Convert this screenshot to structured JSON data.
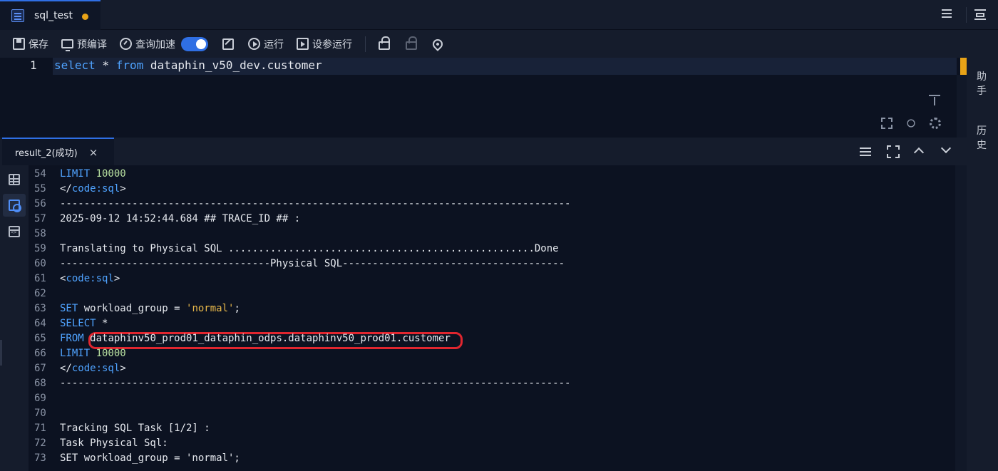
{
  "tab": {
    "title": "sql_test",
    "unsaved_color": "#e8a317"
  },
  "toolbar": {
    "save": "保存",
    "precompile": "预编译",
    "query_accel": "查询加速",
    "query_accel_on": true,
    "run": "运行",
    "run_with_params": "设参运行"
  },
  "editor": {
    "line_number": "1",
    "code_kw1": "select",
    "code_star": " * ",
    "code_kw2": "from",
    "code_rest": " dataphin_v50_dev.customer"
  },
  "side_panel": {
    "assistant": "助手",
    "history": "历史"
  },
  "result": {
    "tab_label": "result_2(成功)",
    "close": "×"
  },
  "log": [
    {
      "n": "54",
      "parts": [
        {
          "t": "LIMIT ",
          "c": "kw"
        },
        {
          "t": "10000",
          "c": "num"
        }
      ]
    },
    {
      "n": "55",
      "parts": [
        {
          "t": "</",
          "c": "txt"
        },
        {
          "t": "code:sql",
          "c": "kw"
        },
        {
          "t": ">",
          "c": "txt"
        }
      ]
    },
    {
      "n": "56",
      "parts": [
        {
          "t": "-------------------------------------------------------------------------------------",
          "c": "txt"
        }
      ]
    },
    {
      "n": "57",
      "parts": [
        {
          "t": "2025-09-12 14:52:44.684 ## TRACE_ID ## :",
          "c": "txt"
        }
      ]
    },
    {
      "n": "58",
      "parts": []
    },
    {
      "n": "59",
      "parts": [
        {
          "t": "Translating to Physical SQL ...................................................Done",
          "c": "txt"
        }
      ]
    },
    {
      "n": "60",
      "parts": [
        {
          "t": "-----------------------------------Physical SQL-------------------------------------",
          "c": "txt"
        }
      ]
    },
    {
      "n": "61",
      "parts": [
        {
          "t": "<",
          "c": "txt"
        },
        {
          "t": "code:sql",
          "c": "kw"
        },
        {
          "t": ">",
          "c": "txt"
        }
      ]
    },
    {
      "n": "62",
      "parts": []
    },
    {
      "n": "63",
      "parts": [
        {
          "t": "SET ",
          "c": "kw"
        },
        {
          "t": "workload_group = ",
          "c": "txt"
        },
        {
          "t": "'normal'",
          "c": "str"
        },
        {
          "t": ";",
          "c": "txt"
        }
      ]
    },
    {
      "n": "64",
      "parts": [
        {
          "t": "SELECT ",
          "c": "kw"
        },
        {
          "t": "*",
          "c": "txt"
        }
      ]
    },
    {
      "n": "65",
      "parts": [
        {
          "t": "FROM ",
          "c": "kw"
        },
        {
          "t": "dataphinv50_prod01_dataphin_odps.dataphinv50_prod01.customer",
          "c": "txt"
        }
      ]
    },
    {
      "n": "66",
      "parts": [
        {
          "t": "LIMIT ",
          "c": "kw"
        },
        {
          "t": "10000",
          "c": "num"
        }
      ]
    },
    {
      "n": "67",
      "parts": [
        {
          "t": "</",
          "c": "txt"
        },
        {
          "t": "code:sql",
          "c": "kw"
        },
        {
          "t": ">",
          "c": "txt"
        }
      ]
    },
    {
      "n": "68",
      "parts": [
        {
          "t": "-------------------------------------------------------------------------------------",
          "c": "txt"
        }
      ]
    },
    {
      "n": "69",
      "parts": []
    },
    {
      "n": "70",
      "parts": []
    },
    {
      "n": "71",
      "parts": [
        {
          "t": "Tracking SQL Task [1/2] :",
          "c": "txt"
        }
      ]
    },
    {
      "n": "72",
      "parts": [
        {
          "t": "Task Physical Sql:",
          "c": "txt"
        }
      ]
    },
    {
      "n": "73",
      "parts": [
        {
          "t": "SET workload_group = 'normal';",
          "c": "txt"
        }
      ]
    }
  ]
}
